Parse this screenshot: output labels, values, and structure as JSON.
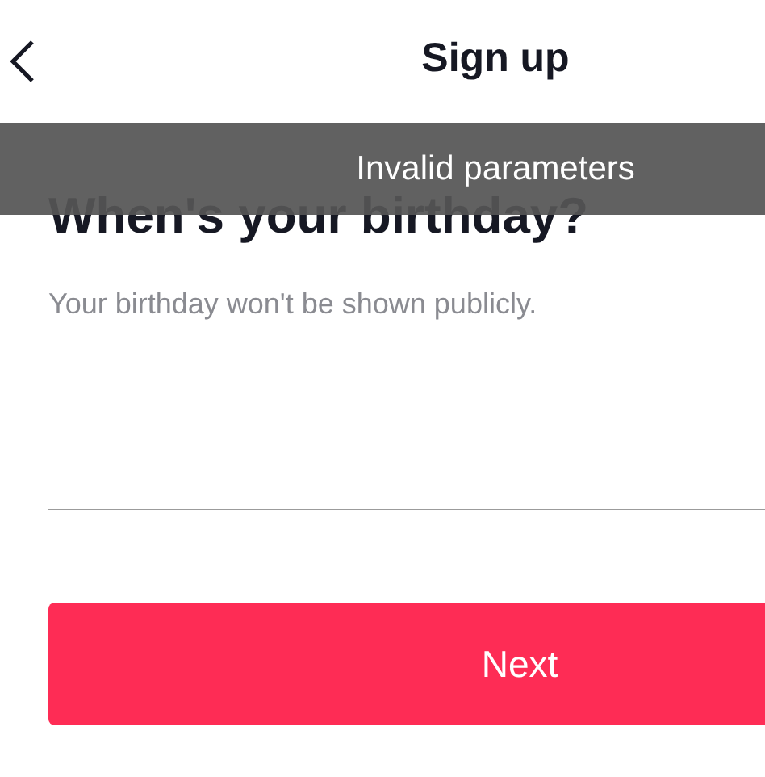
{
  "header": {
    "title": "Sign up"
  },
  "toast": {
    "message": "Invalid parameters"
  },
  "heading": "When's your birthday?",
  "subtitle": "Your birthday won't be shown publicly.",
  "buttons": [
    {
      "label": "Next"
    }
  ]
}
